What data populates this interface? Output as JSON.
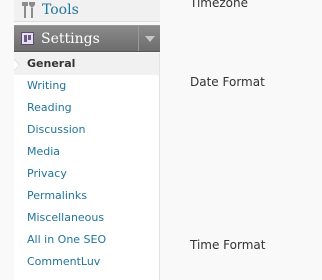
{
  "sidebar": {
    "tools": {
      "label": "Tools",
      "icon": "tools-icon"
    },
    "settings": {
      "label": "Settings",
      "icon": "settings-icon",
      "toggle_icon": "chevron-down-icon",
      "expanded": true
    },
    "submenu": [
      {
        "label": "General",
        "current": true
      },
      {
        "label": "Writing"
      },
      {
        "label": "Reading"
      },
      {
        "label": "Discussion"
      },
      {
        "label": "Media"
      },
      {
        "label": "Privacy"
      },
      {
        "label": "Permalinks"
      },
      {
        "label": "Miscellaneous"
      },
      {
        "label": "All in One SEO"
      },
      {
        "label": "CommentLuv"
      }
    ]
  },
  "main": {
    "fields": {
      "timezone_label": "Timezone",
      "date_format_label": "Date Format",
      "time_format_label": "Time Format"
    }
  },
  "colors": {
    "link": "#21759b",
    "menu_header_bg": "#7a7a7a",
    "page_bg": "#f9f9f9"
  }
}
